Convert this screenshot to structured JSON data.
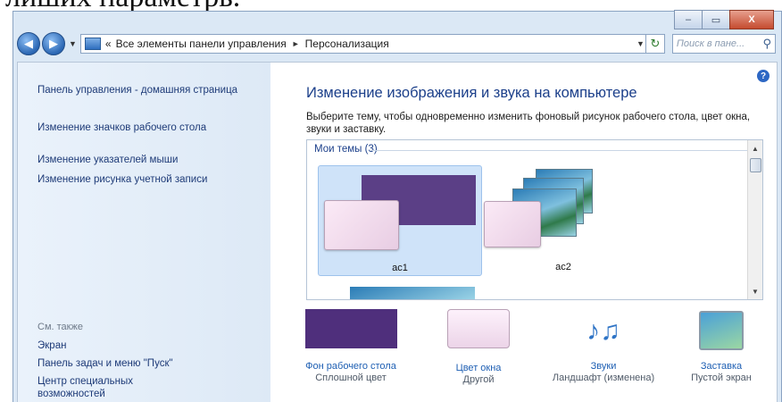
{
  "doc_text": "лиших параметрь.",
  "window": {
    "caption_buttons": [
      "–",
      "▭",
      "X"
    ]
  },
  "navbar": {
    "back_symbol": "◀",
    "forward_symbol": "▶",
    "dropdown_symbol": "▼",
    "breadcrumb_overflow": "«",
    "breadcrumb": [
      "Все элементы панели управления",
      "Персонализация"
    ],
    "breadcrumb_separator": "►",
    "refresh_symbol": "↻",
    "search_placeholder": "Поиск в пане...",
    "search_icon_symbol": "⚲"
  },
  "left_pane": {
    "links": [
      "Панель управления - домашняя страница",
      "Изменение значков рабочего стола",
      "Изменение указателей мыши",
      "Изменение рисунка учетной записи"
    ],
    "see_also_label": "См. также",
    "see_also_links": [
      "Экран",
      "Панель задач и меню \"Пуск\"",
      "Центр специальных возможностей"
    ]
  },
  "main": {
    "help_symbol": "?",
    "title": "Изменение изображения и звука на компьютере",
    "description": "Выберите тему, чтобы одновременно изменить фоновый рисунок рабочего стола, цвет окна, звуки и заставку.",
    "group_header": "Мои темы (3)",
    "themes": [
      {
        "name": "ас1",
        "selected": true
      },
      {
        "name": "ас2",
        "selected": false
      }
    ],
    "bottom_items": [
      {
        "link": "Фон рабочего стола",
        "sub": "Сплошной цвет"
      },
      {
        "link": "Цвет окна",
        "sub": "Другой"
      },
      {
        "link": "Звуки",
        "sub": "Ландшафт (изменена)"
      },
      {
        "link": "Заставка",
        "sub": "Пустой экран"
      }
    ],
    "sounds_icon_symbol": "♪♫"
  },
  "colors": {
    "link": "#1e3b78",
    "title": "#1b3f8a",
    "theme_purple": "#5b3f86",
    "selection": "#cfe3f9"
  }
}
